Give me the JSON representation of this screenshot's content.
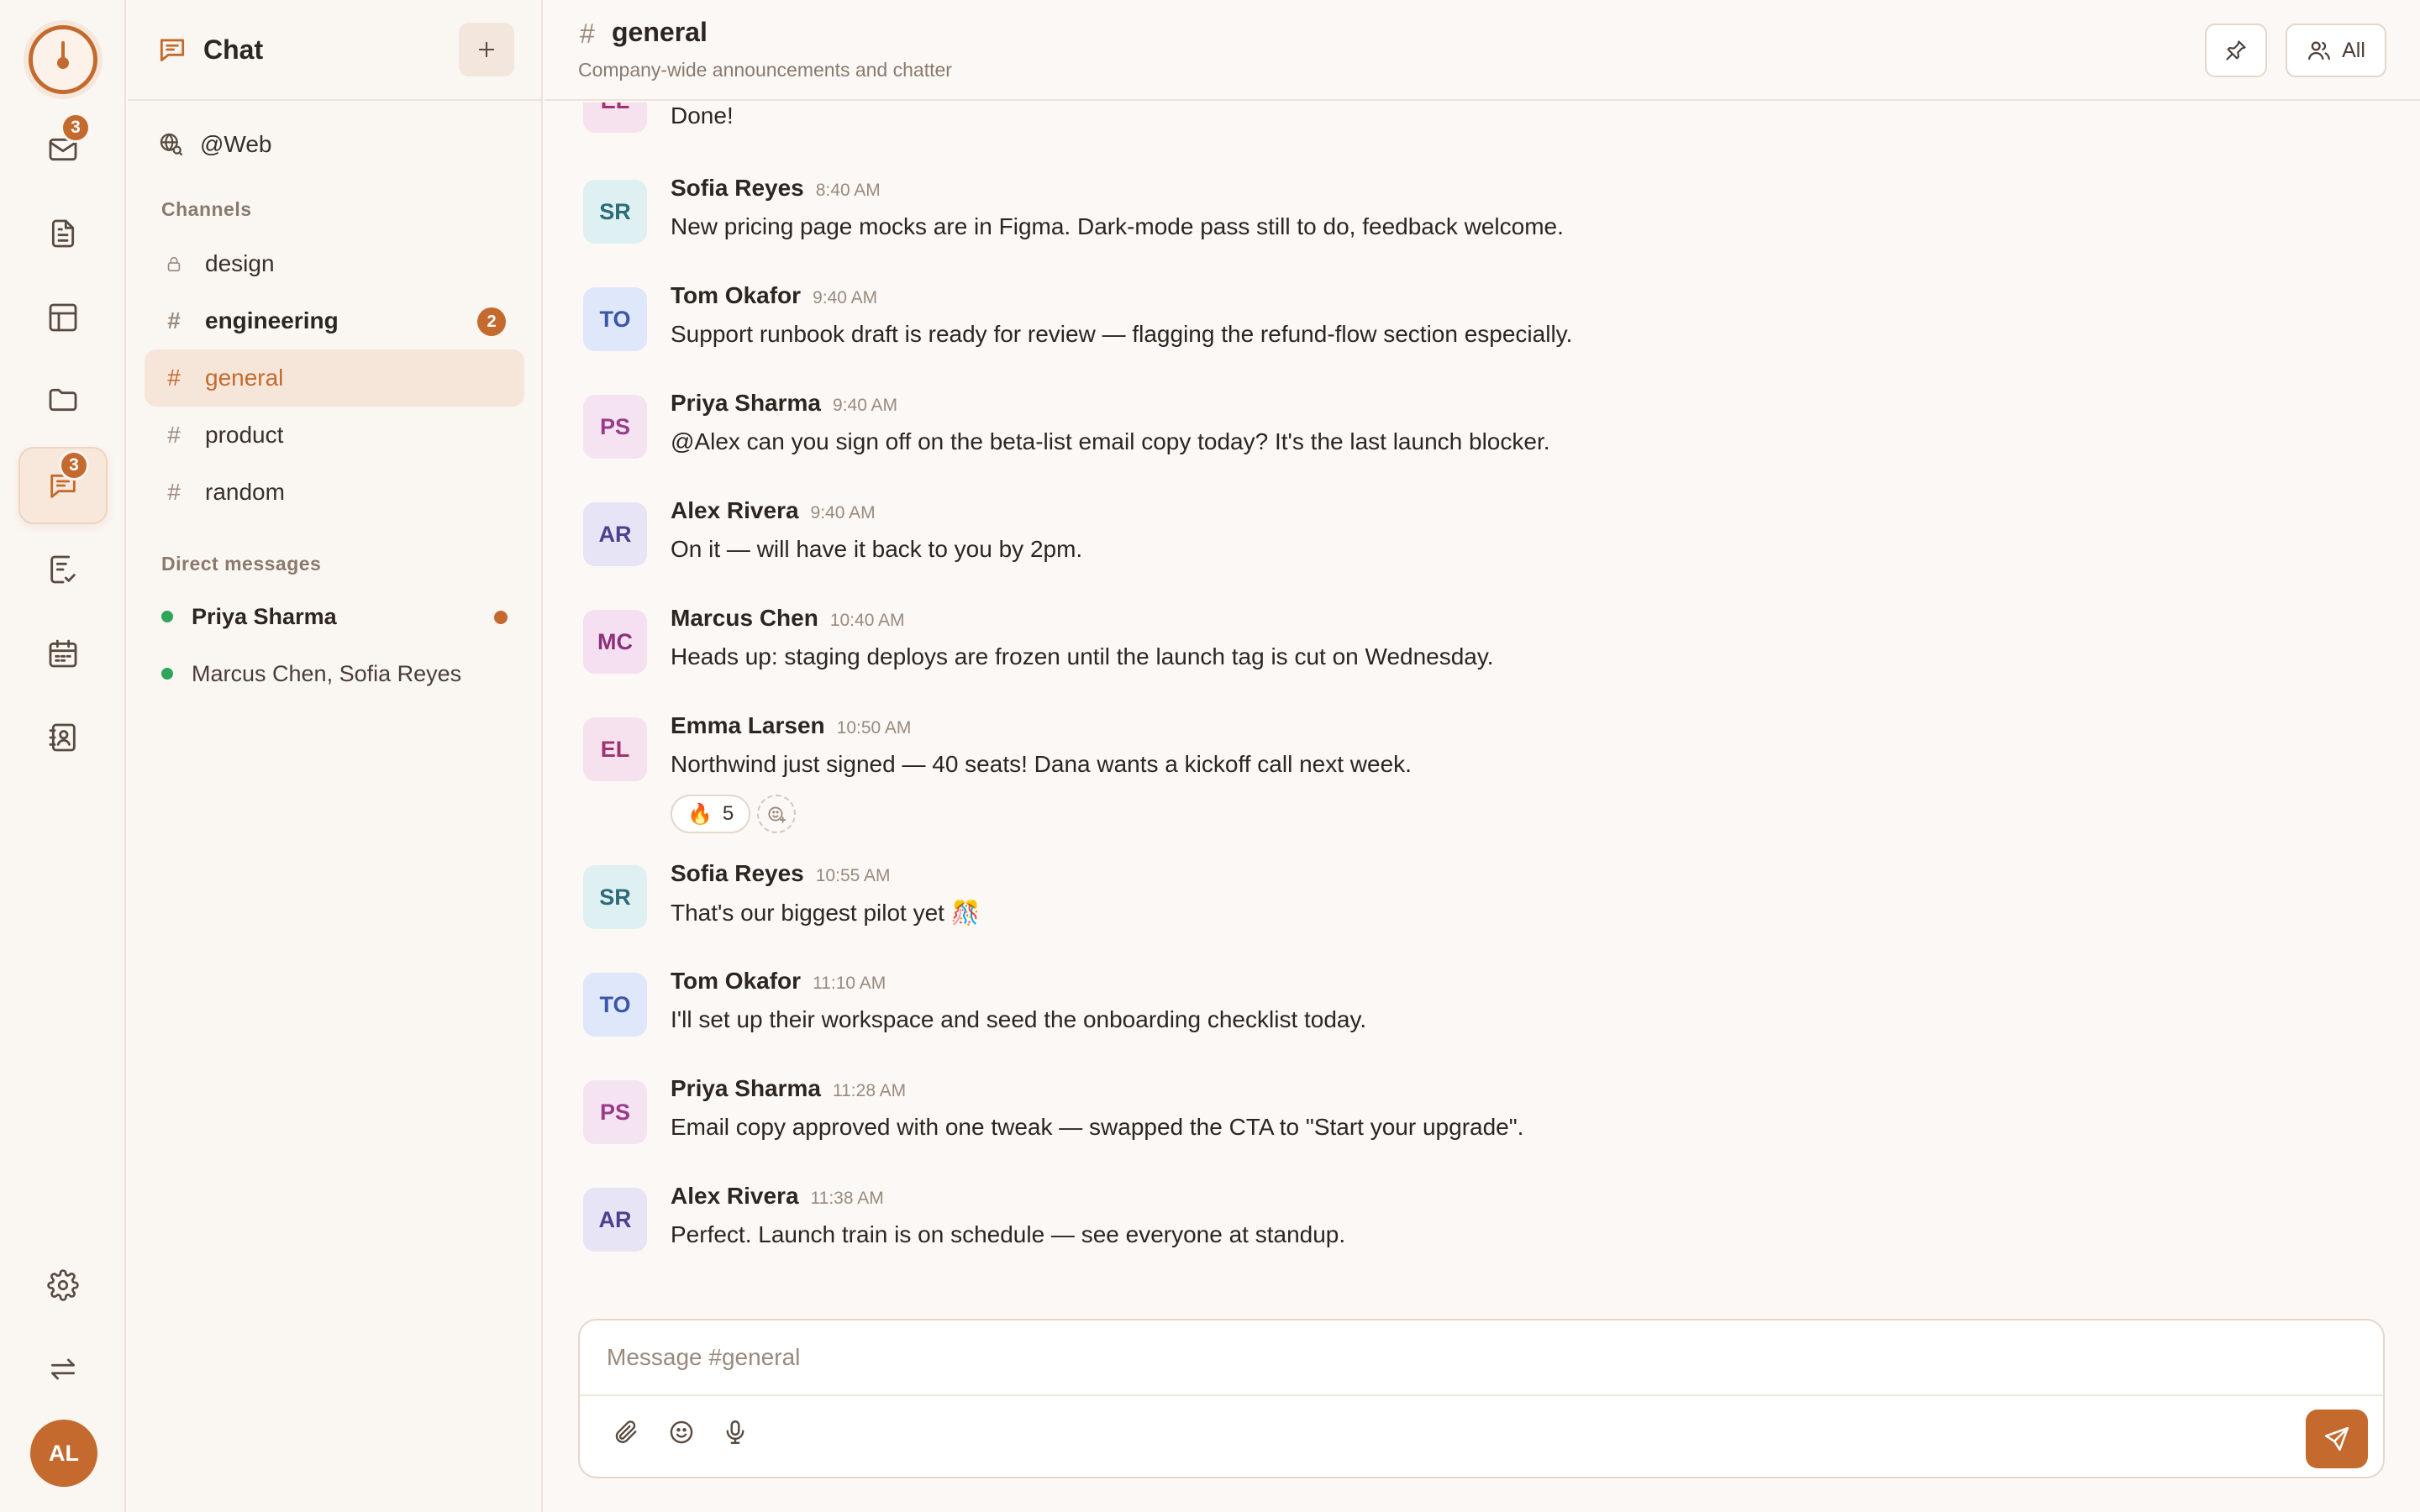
{
  "rail": {
    "logo_icon": "timer-icon",
    "items": [
      {
        "icon": "mail-icon",
        "badge": "3"
      },
      {
        "icon": "document-icon",
        "badge": ""
      },
      {
        "icon": "table-icon",
        "badge": ""
      },
      {
        "icon": "folder-icon",
        "badge": ""
      },
      {
        "icon": "chat-icon",
        "badge": "3",
        "active": true
      },
      {
        "icon": "task-check-icon",
        "badge": ""
      },
      {
        "icon": "calendar-icon",
        "badge": ""
      },
      {
        "icon": "contacts-icon",
        "badge": ""
      }
    ],
    "bottom": [
      {
        "icon": "settings-icon"
      },
      {
        "icon": "switch-icon"
      }
    ],
    "user_initials": "AL"
  },
  "sidebar": {
    "title": "Chat",
    "web_label": "@Web",
    "channels_heading": "Channels",
    "channels": [
      {
        "name": "design",
        "prefix": "lock",
        "count": ""
      },
      {
        "name": "engineering",
        "prefix": "#",
        "count": "2"
      },
      {
        "name": "general",
        "prefix": "#",
        "count": ""
      },
      {
        "name": "product",
        "prefix": "#",
        "count": ""
      },
      {
        "name": "random",
        "prefix": "#",
        "count": ""
      }
    ],
    "dm_heading": "Direct messages",
    "dms": [
      {
        "name": "Priya Sharma",
        "unread": true
      },
      {
        "name": "Marcus Chen, Sofia Reyes",
        "unread": false
      }
    ]
  },
  "header": {
    "channel": "general",
    "hash": "#",
    "description": "Company-wide announcements and chatter",
    "members_label": "All"
  },
  "messages": [
    {
      "initials": "EL",
      "name": "",
      "time": "",
      "text": "Done!"
    },
    {
      "initials": "SR",
      "name": "Sofia Reyes",
      "time": "8:40 AM",
      "text": "New pricing page mocks are in Figma. Dark-mode pass still to do, feedback welcome."
    },
    {
      "initials": "TO",
      "name": "Tom Okafor",
      "time": "9:40 AM",
      "text": "Support runbook draft is ready for review — flagging the refund-flow section especially."
    },
    {
      "initials": "PS",
      "name": "Priya Sharma",
      "time": "9:40 AM",
      "text": "@Alex can you sign off on the beta-list email copy today? It's the last launch blocker."
    },
    {
      "initials": "AR",
      "name": "Alex Rivera",
      "time": "9:40 AM",
      "text": "On it — will have it back to you by 2pm."
    },
    {
      "initials": "MC",
      "name": "Marcus Chen",
      "time": "10:40 AM",
      "text": "Heads up: staging deploys are frozen until the launch tag is cut on Wednesday."
    },
    {
      "initials": "EL",
      "name": "Emma Larsen",
      "time": "10:50 AM",
      "text": "Northwind just signed — 40 seats! Dana wants a kickoff call next week.",
      "reaction_emoji": "🔥",
      "reaction_count": "5"
    },
    {
      "initials": "SR",
      "name": "Sofia Reyes",
      "time": "10:55 AM",
      "text": "That's our biggest pilot yet 🎊"
    },
    {
      "initials": "TO",
      "name": "Tom Okafor",
      "time": "11:10 AM",
      "text": "I'll set up their workspace and seed the onboarding checklist today."
    },
    {
      "initials": "PS",
      "name": "Priya Sharma",
      "time": "11:28 AM",
      "text": "Email copy approved with one tweak — swapped the CTA to \"Start your upgrade\"."
    },
    {
      "initials": "AR",
      "name": "Alex Rivera",
      "time": "11:38 AM",
      "text": "Perfect. Launch train is on schedule — see everyone at standup."
    }
  ],
  "composer": {
    "placeholder": "Message #general",
    "tools": [
      "attach-icon",
      "emoji-icon",
      "microphone-icon"
    ],
    "send_icon": "send-icon"
  },
  "colors": {
    "accent": "#c46a2e",
    "presence": "#2fa55a",
    "selected_bg": "#f6e6da"
  }
}
